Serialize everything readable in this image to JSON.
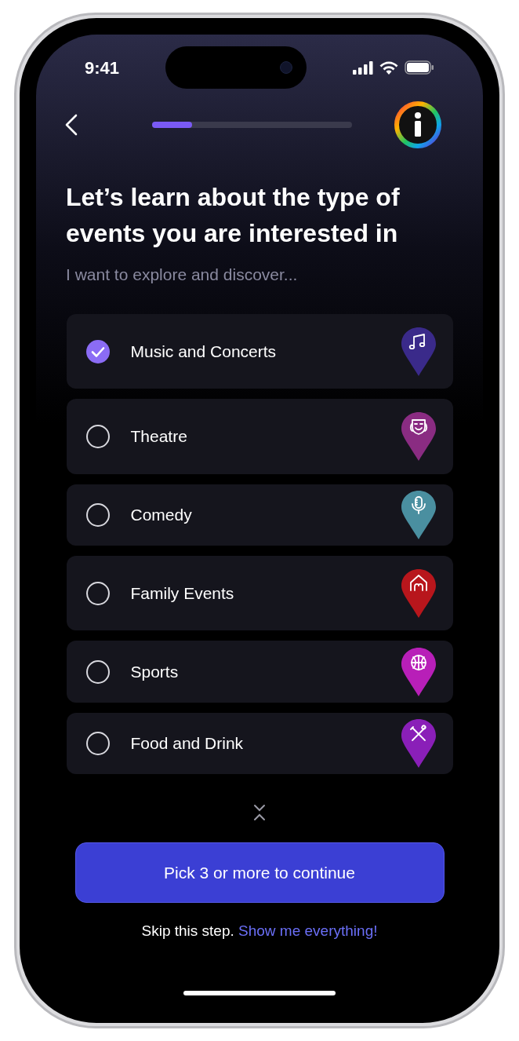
{
  "status_bar": {
    "time": "9:41"
  },
  "progress": {
    "level": 0.2
  },
  "title": "Let’s learn about the type of events you are interested in",
  "subtitle": "I want to explore and discover...",
  "categories": [
    {
      "label": "Music and Concerts",
      "selected": true,
      "kind": "music",
      "color": "#3a2a8a"
    },
    {
      "label": "Theatre",
      "selected": false,
      "kind": "theatre",
      "color": "#8a2c82"
    },
    {
      "label": "Comedy",
      "selected": false,
      "kind": "comedy",
      "color": "#4a8fa0"
    },
    {
      "label": "Family Events",
      "selected": false,
      "kind": "family",
      "color": "#b8161c"
    },
    {
      "label": "Sports",
      "selected": false,
      "kind": "sports",
      "color": "#b81fb8"
    },
    {
      "label": "Food and Drink",
      "selected": false,
      "kind": "food",
      "color": "#8a1fb8"
    }
  ],
  "continue_button": "Pick 3 or more to continue",
  "skip": {
    "text": "Skip this step.",
    "link": "Show me everything!"
  }
}
